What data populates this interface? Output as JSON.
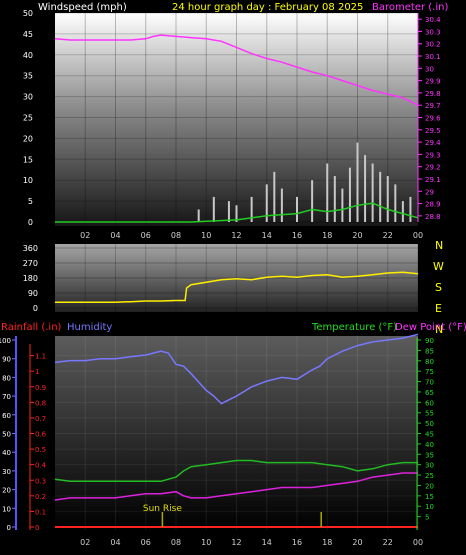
{
  "header": {
    "wind_label": "Windspeed (mph)",
    "title": "24 hour graph day : February 08 2025",
    "baro_label": "Barometer (.in)"
  },
  "compass": [
    "N",
    "W",
    "S",
    "E",
    "N"
  ],
  "lower_header": {
    "rain_label": "Rainfall (.in)",
    "humidity_label": "Humidity",
    "temp_label": "Temperature (°F)",
    "dew_label": "Dew Point (°F)"
  },
  "annotation": {
    "sunrise": "Sun Rise"
  },
  "colors": {
    "wind": "#ffffff",
    "gust_bar": "#c8c8c8",
    "wind_green": "#22cc22",
    "barometer": "#ff33ff",
    "direction": "#ffee00",
    "humidity": "#7777ff",
    "temperature": "#22bb22",
    "dewpoint": "#dd22dd",
    "rainfall": "#ff2222",
    "sun_marker": "#aaaa00"
  },
  "chart_data": [
    {
      "type": "line",
      "id": "wind_baro",
      "title": "24 hour graph day : February 08 2025",
      "xlabel": "",
      "ylabel": "Windspeed (mph)",
      "y2label": "Barometer (.in)",
      "x_ticks": [
        "02",
        "04",
        "06",
        "08",
        "10",
        "12",
        "14",
        "16",
        "18",
        "20",
        "22",
        "00"
      ],
      "x_range": [
        0,
        24
      ],
      "ylim": [
        0,
        50
      ],
      "y_ticks": [
        0,
        5,
        10,
        15,
        20,
        25,
        30,
        35,
        40,
        45,
        50
      ],
      "y2lim": [
        28.75,
        30.45
      ],
      "y2_ticks": [
        "28.8",
        "28.9",
        "29",
        "29.1",
        "29.2",
        "29.3",
        "29.4",
        "29.5",
        "29.6",
        "29.7",
        "29.8",
        "29.9",
        "30",
        "30.1",
        "30.2",
        "30.3",
        "30.4"
      ],
      "grid": true,
      "series": [
        {
          "name": "Barometer (.in)",
          "x": [
            0,
            1,
            2,
            3,
            4,
            5,
            6,
            6.5,
            7,
            8,
            9,
            10,
            11,
            12,
            13,
            14,
            15,
            16,
            17,
            18,
            19,
            20,
            21,
            22,
            23,
            24
          ],
          "y": [
            30.24,
            30.23,
            30.23,
            30.23,
            30.23,
            30.23,
            30.24,
            30.26,
            30.27,
            30.26,
            30.25,
            30.24,
            30.22,
            30.17,
            30.12,
            30.08,
            30.05,
            30.01,
            29.97,
            29.94,
            29.9,
            29.86,
            29.82,
            29.79,
            29.76,
            29.7
          ]
        },
        {
          "name": "Wind gust (mph)",
          "x": [
            9.5,
            10.5,
            11.5,
            12,
            13,
            14,
            14.5,
            15,
            16,
            17,
            18,
            18.5,
            19,
            19.5,
            20,
            20.5,
            21,
            21.5,
            22,
            22.5,
            23,
            23.5
          ],
          "y": [
            3,
            6,
            5,
            4,
            6,
            9,
            12,
            8,
            6,
            10,
            14,
            11,
            8,
            13,
            19,
            16,
            14,
            12,
            11,
            9,
            5,
            6
          ]
        },
        {
          "name": "Wind avg (mph)",
          "x": [
            0,
            9,
            12,
            14,
            16,
            17,
            18,
            19,
            20,
            21,
            22,
            23,
            24
          ],
          "y": [
            0,
            0,
            0.5,
            1.5,
            2,
            3,
            2.5,
            3,
            4,
            4.5,
            3,
            2,
            1
          ]
        }
      ]
    },
    {
      "type": "line",
      "id": "wind_direction",
      "ylabel": "",
      "ylim": [
        0,
        360
      ],
      "y_ticks": [
        0,
        90,
        180,
        270,
        360
      ],
      "x_ticks": [
        "02",
        "04",
        "06",
        "08",
        "10",
        "12",
        "14",
        "16",
        "18",
        "20",
        "22",
        "00"
      ],
      "x_range": [
        0,
        24
      ],
      "series": [
        {
          "name": "Wind direction (deg)",
          "x": [
            0,
            1,
            2,
            3,
            4,
            5,
            6,
            7,
            8,
            8.6,
            8.7,
            9,
            10,
            11,
            12,
            13,
            14,
            15,
            16,
            17,
            18,
            19,
            20,
            21,
            22,
            23,
            24
          ],
          "y": [
            35,
            35,
            35,
            35,
            35,
            38,
            42,
            42,
            45,
            45,
            120,
            140,
            155,
            170,
            175,
            170,
            185,
            190,
            185,
            195,
            200,
            185,
            190,
            200,
            210,
            215,
            205
          ]
        }
      ]
    },
    {
      "type": "line",
      "id": "climate",
      "ylabel": "Humidity",
      "rain_ylabel": "Rainfall (.in)",
      "y2label": "Temperature (°F) Dew Point (°F)",
      "x_ticks": [
        "02",
        "04",
        "06",
        "08",
        "10",
        "12",
        "14",
        "16",
        "18",
        "20",
        "22",
        "00"
      ],
      "x_range": [
        0,
        24
      ],
      "ylim": [
        0,
        100
      ],
      "humidity_ticks": [
        0,
        10,
        20,
        30,
        40,
        50,
        60,
        70,
        80,
        90,
        100
      ],
      "rain_ylim": [
        0,
        1.2
      ],
      "rain_ticks": [
        "0",
        "0.1",
        "0.2",
        "0.3",
        "0.4",
        "0.5",
        "0.6",
        "0.7",
        "0.8",
        "0.9",
        "1",
        "1.1"
      ],
      "y2lim": [
        0,
        90
      ],
      "temp_ticks": [
        5,
        10,
        15,
        20,
        25,
        30,
        35,
        40,
        45,
        50,
        55,
        60,
        65,
        70,
        75,
        80,
        85,
        90
      ],
      "annotations": [
        {
          "text": "Sun Rise",
          "x": 7.1
        }
      ],
      "series": [
        {
          "name": "Humidity",
          "x": [
            0,
            1,
            2,
            3,
            4,
            5,
            6,
            6.5,
            7,
            7.5,
            8,
            8.5,
            9,
            10,
            10.5,
            11,
            12,
            13,
            14,
            15,
            16,
            17,
            17.5,
            18,
            19,
            20,
            21,
            22,
            23,
            24
          ],
          "y": [
            88,
            89,
            89,
            90,
            90,
            91,
            92,
            93,
            94,
            93,
            87,
            86,
            82,
            73,
            70,
            66,
            70,
            75,
            78,
            80,
            79,
            84,
            86,
            90,
            94,
            97,
            99,
            100,
            101,
            103
          ]
        },
        {
          "name": "Temperature (°F)",
          "x": [
            0,
            1,
            2,
            3,
            4,
            5,
            6,
            7,
            8,
            8.5,
            9,
            10,
            11,
            12,
            13,
            14,
            15,
            16,
            17,
            18,
            19,
            20,
            21,
            22,
            23,
            24
          ],
          "y": [
            23,
            22,
            22,
            22,
            22,
            22,
            22,
            22,
            24,
            27,
            29,
            30,
            31,
            32,
            32,
            31,
            31,
            31,
            31,
            30,
            29,
            27,
            28,
            30,
            31,
            31
          ]
        },
        {
          "name": "Dew Point (°F)",
          "x": [
            0,
            1,
            2,
            3,
            4,
            5,
            6,
            7,
            8,
            8.5,
            9,
            10,
            11,
            12,
            13,
            14,
            15,
            16,
            17,
            18,
            19,
            20,
            21,
            22,
            23,
            24
          ],
          "y": [
            13,
            14,
            14,
            14,
            14,
            15,
            16,
            16,
            17,
            15,
            14,
            14,
            15,
            16,
            17,
            18,
            19,
            19,
            19,
            20,
            21,
            22,
            24,
            25,
            26,
            26
          ]
        },
        {
          "name": "Rainfall (.in)",
          "x": [
            0,
            24
          ],
          "y": [
            0,
            0
          ]
        }
      ]
    }
  ]
}
